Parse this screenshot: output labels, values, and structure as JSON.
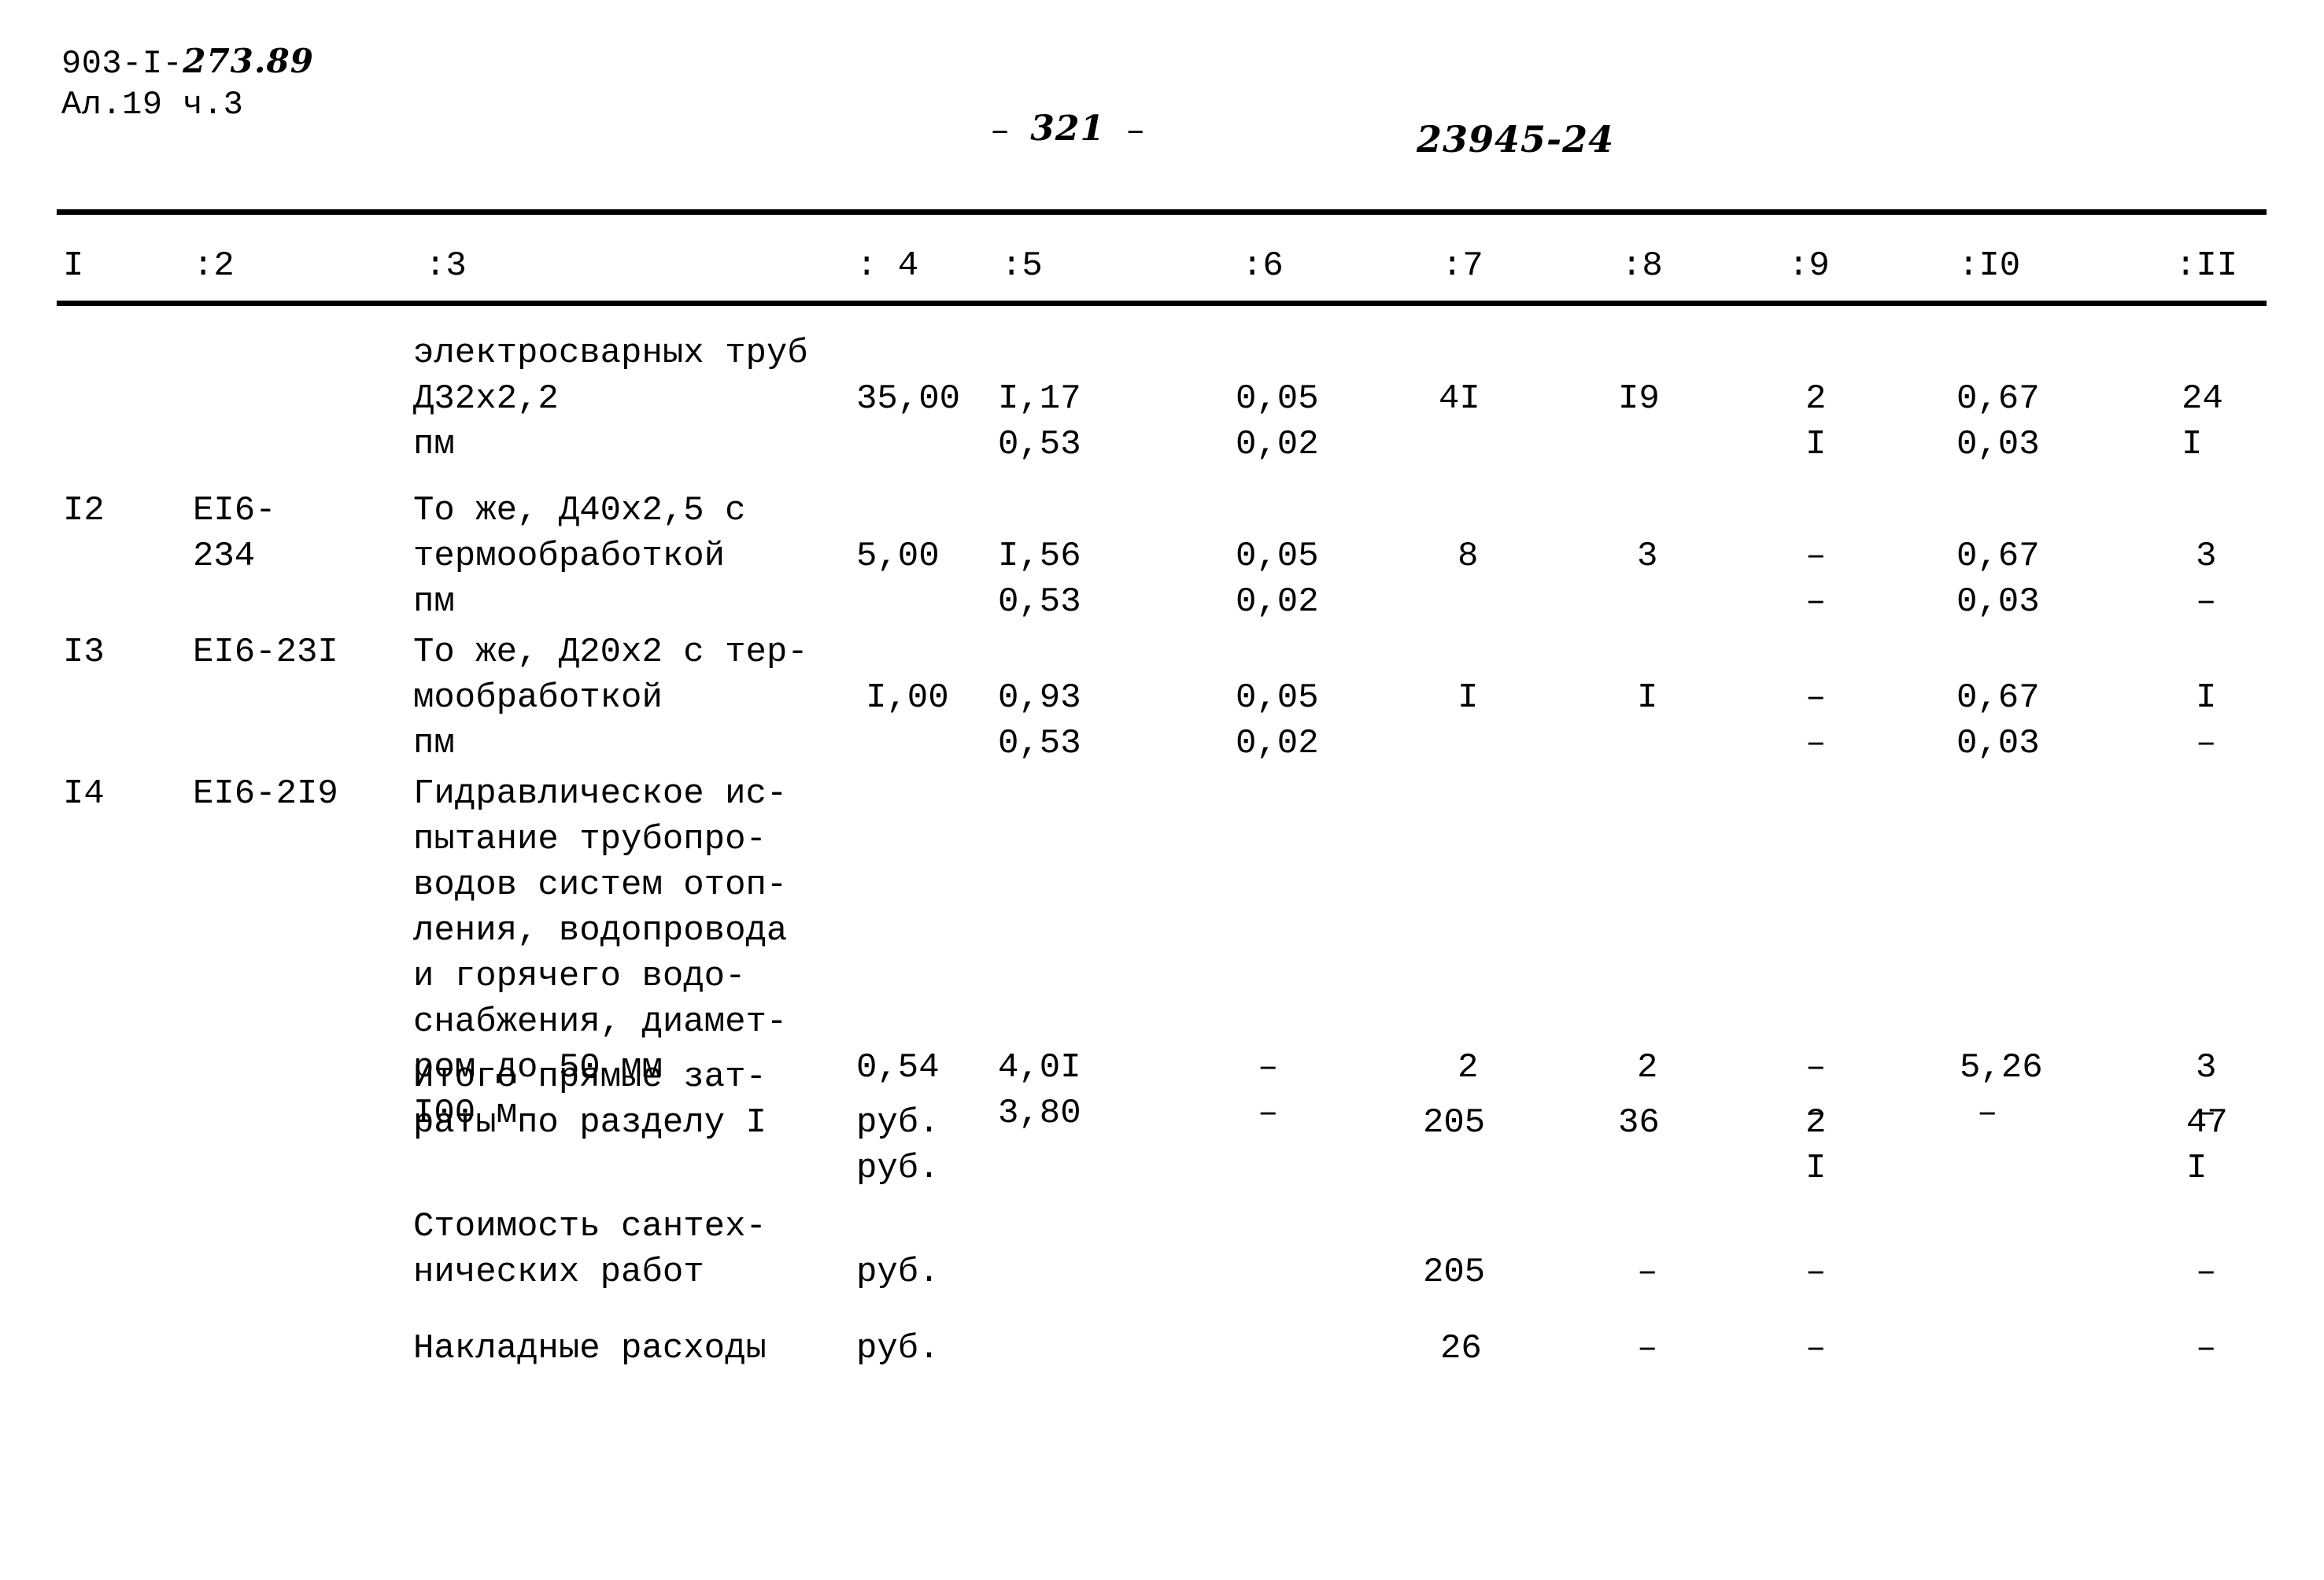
{
  "header": {
    "doc_code_prefix": "903-I-",
    "doc_code_hand": "273.89",
    "album_line": "Ал.19 ч.3",
    "page_dash_left": "–",
    "page_number": "321",
    "page_dash_right": "–",
    "stamp_number": "23945-24"
  },
  "table": {
    "column_headers": [
      "I",
      ":2",
      ":3",
      ": 4",
      ":5",
      ":6",
      ":7",
      ":8",
      ":9",
      ":I0",
      ":II"
    ],
    "rows": [
      {
        "name": "row-continuation-electro-pipes",
        "c1": "",
        "c2": "",
        "c3": "электросварных труб\nД32х2,2\nпм",
        "c4": "35,00",
        "c5a": "I,17",
        "c5b": "0,53",
        "c6a": "0,05",
        "c6b": "0,02",
        "c7a": "4I",
        "c7b": "",
        "c8a": "I9",
        "c8b": "",
        "c9a": "2",
        "c9b": "I",
        "c10a": "0,67",
        "c10b": "0,03",
        "c11a": "24",
        "c11b": "I"
      },
      {
        "name": "row-12",
        "c1": "I2",
        "c2": "EI6-\n234",
        "c3": "То же, Д40х2,5 с\nтермообработкой\nпм",
        "c4": "5,00",
        "c5a": "I,56",
        "c5b": "0,53",
        "c6a": "0,05",
        "c6b": "0,02",
        "c7a": "8",
        "c7b": "",
        "c8a": "3",
        "c8b": "",
        "c9a": "–",
        "c9b": "–",
        "c10a": "0,67",
        "c10b": "0,03",
        "c11a": "3",
        "c11b": "–"
      },
      {
        "name": "row-13",
        "c1": "I3",
        "c2": "EI6-23I",
        "c3": "То же, Д20х2 с тер-\nмообработкой\nпм",
        "c4": "I,00",
        "c5a": "0,93",
        "c5b": "0,53",
        "c6a": "0,05",
        "c6b": "0,02",
        "c7a": "I",
        "c7b": "",
        "c8a": "I",
        "c8b": "",
        "c9a": "–",
        "c9b": "–",
        "c10a": "0,67",
        "c10b": "0,03",
        "c11a": "I",
        "c11b": "–"
      },
      {
        "name": "row-14",
        "c1": "I4",
        "c2": "EI6-2I9",
        "c3": "Гидравлическое ис-\nпытание трубопро-\nводов систем отоп-\nления, водопровода\nи горячего водо-\nснабжения, диамет-\nром до 50 мм\nI00 м",
        "c4": "0,54",
        "c5a": "4,0I",
        "c5b": "3,80",
        "c6a": "–",
        "c6b": "–",
        "c7a": "2",
        "c7b": "",
        "c8a": "2",
        "c8b": "",
        "c9a": "–",
        "c9b": "–",
        "c10a": "5,26",
        "c10b": "–",
        "c11a": "3",
        "c11b": "–"
      },
      {
        "name": "row-total-direct-costs",
        "c1": "",
        "c2": "",
        "c3": "Итого прямые зат-\nраты по разделу I",
        "c4": "руб.",
        "c4b": "руб.",
        "c5a": "",
        "c5b": "",
        "c6a": "",
        "c6b": "",
        "c7a": "205",
        "c7b": "",
        "c8a": "36",
        "c8b": "",
        "c9a": "2",
        "c9b": "I",
        "c10a": "",
        "c10b": "",
        "c11a": "47",
        "c11b": "I"
      },
      {
        "name": "row-plumbing-works-cost",
        "c1": "",
        "c2": "",
        "c3": "Стоимость сантех-\nнических работ",
        "c4": "руб.",
        "c5a": "",
        "c5b": "",
        "c6a": "",
        "c6b": "",
        "c7a": "205",
        "c7b": "",
        "c8a": "–",
        "c8b": "",
        "c9a": "–",
        "c9b": "",
        "c10a": "",
        "c10b": "",
        "c11a": "–",
        "c11b": ""
      },
      {
        "name": "row-overheads",
        "c1": "",
        "c2": "",
        "c3": "Накладные расходы",
        "c4": "руб.",
        "c5a": "",
        "c5b": "",
        "c6a": "",
        "c6b": "",
        "c7a": "26",
        "c7b": "",
        "c8a": "–",
        "c8b": "",
        "c9a": "–",
        "c9b": "",
        "c10a": "",
        "c10b": "",
        "c11a": "–",
        "c11b": ""
      }
    ]
  }
}
